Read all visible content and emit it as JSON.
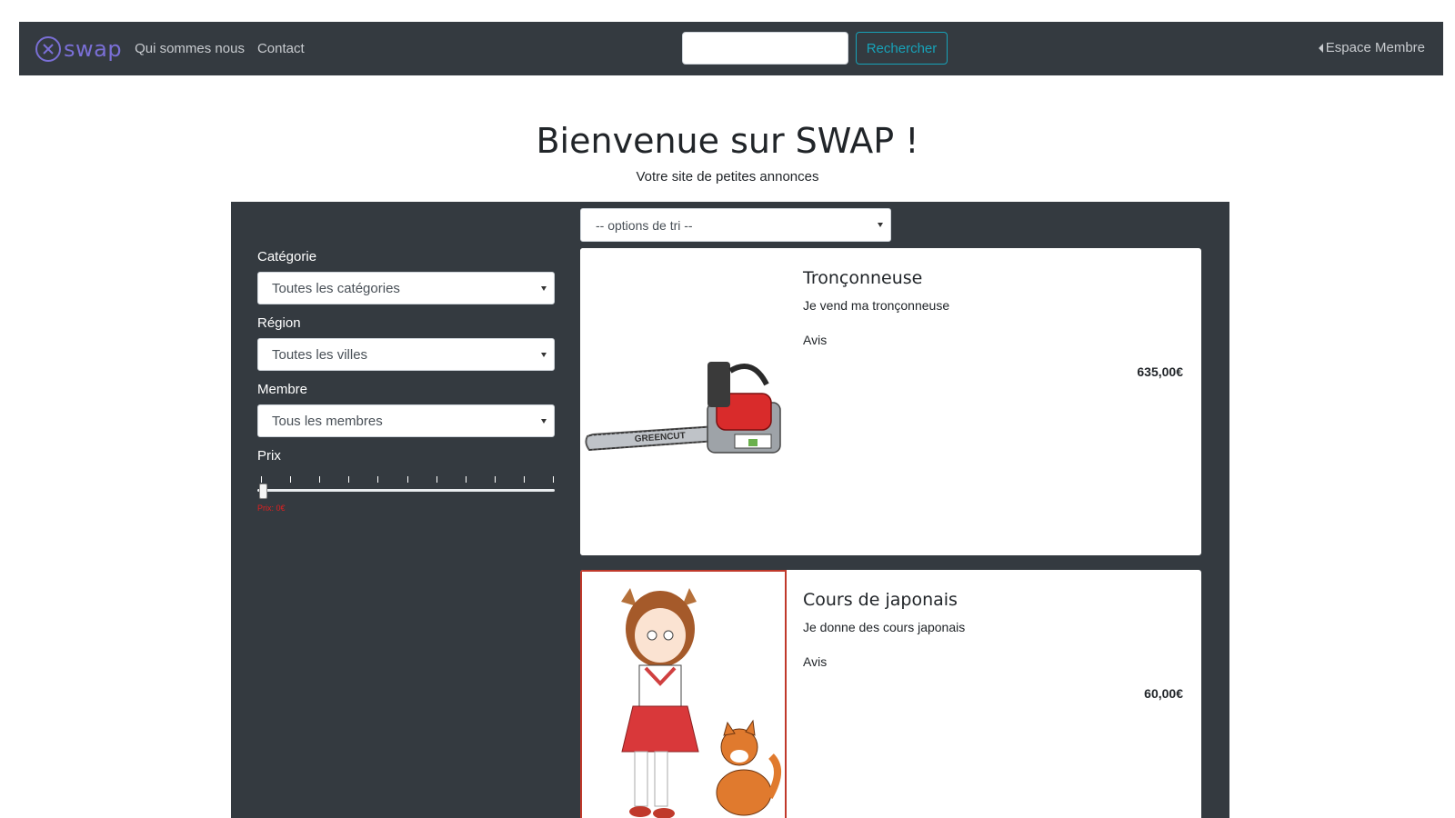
{
  "navbar": {
    "brand": "swap",
    "links": [
      "Qui sommes nous",
      "Contact"
    ],
    "search_placeholder": "",
    "search_button": "Rechercher",
    "member_link": "Espace Membre"
  },
  "hero": {
    "title": "Bienvenue sur SWAP !",
    "subtitle": "Votre site de petites annonces"
  },
  "sort": {
    "selected": "-- options de tri --"
  },
  "filters": {
    "category": {
      "label": "Catégorie",
      "selected": "Toutes les catégories"
    },
    "region": {
      "label": "Région",
      "selected": "Toutes les villes"
    },
    "member": {
      "label": "Membre",
      "selected": "Tous les membres"
    },
    "price": {
      "label": "Prix",
      "value_text": "Prix: 0€",
      "value_fraction": 0
    }
  },
  "listings": [
    {
      "title": "Tronçonneuse",
      "description": "Je vend ma tronçonneuse",
      "avis": "Avis",
      "price": "635,00€",
      "image": "chainsaw-image",
      "brand_text": "GREENCUT"
    },
    {
      "title": "Cours de japonais",
      "description": "Je donne des cours japonais",
      "avis": "Avis",
      "price": "60,00€",
      "image": "anime-girl-cat-image"
    }
  ],
  "colors": {
    "navbar_bg": "#343a40",
    "brand": "#7a6fd6",
    "search_button": "#17a2b8",
    "panel_bg": "#343a40"
  }
}
